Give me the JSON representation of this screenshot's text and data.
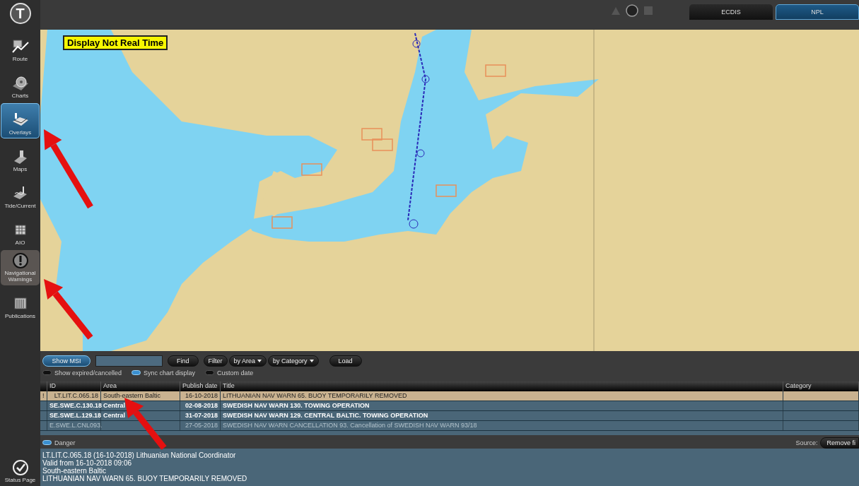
{
  "logo": "T",
  "sidebar": {
    "items": [
      {
        "label": "Route",
        "on": false,
        "selected": false
      },
      {
        "label": "Charts",
        "on": false,
        "selected": false
      },
      {
        "label": "Overlays",
        "on": true,
        "selected": false
      },
      {
        "label": "Maps",
        "on": false,
        "selected": false
      },
      {
        "label": "Tide/Current",
        "on": false,
        "selected": false
      },
      {
        "label": "AIO",
        "on": false,
        "selected": false
      },
      {
        "label": "Navigational Warnings",
        "on": false,
        "selected": true
      },
      {
        "label": "Publications",
        "on": false,
        "selected": false
      }
    ],
    "status": {
      "label": "Status Page"
    }
  },
  "top_tabs": [
    {
      "label": "ECDIS",
      "selected": false
    },
    {
      "label": "NPL",
      "selected": true
    }
  ],
  "map": {
    "banner": "Display Not Real Time"
  },
  "toolbar": {
    "show_msi": {
      "label": "Show MSI",
      "on": true
    },
    "find": "Find",
    "filter": "Filter",
    "dropdowns": [
      "by Area",
      "by Category"
    ],
    "load": "Load"
  },
  "options": [
    {
      "label": "Show expired/cancelled",
      "checked": false
    },
    {
      "label": "Sync chart display",
      "checked": true
    },
    {
      "label": "Custom date",
      "checked": false
    }
  ],
  "table": {
    "columns": [
      "ID",
      "Area",
      "Publish date",
      "Title",
      "Category"
    ],
    "rows": [
      {
        "flag": "!",
        "id": "LT.LIT.C.065.18",
        "area": "South-eastern Baltic",
        "date": "16-10-2018",
        "title": "LITHUANIAN NAV WARN 65. BUOY TEMPORARILY REMOVED",
        "selected": true,
        "unread": false,
        "expired": false
      },
      {
        "id": "SE.SWE.C.130.18",
        "area": "Central",
        "date": "02-08-2018",
        "title": "SWEDISH NAV WARN 130. TOWING OPERATION",
        "selected": false,
        "unread": true,
        "expired": false
      },
      {
        "id": "SE.SWE.L.129.18",
        "area": "Central",
        "date": "31-07-2018",
        "title": "SWEDISH NAV WARN 129. CENTRAL BALTIC. TOWING OPERATION",
        "selected": false,
        "unread": true,
        "expired": false
      },
      {
        "id": "E.SWE.L.CNL093.",
        "date": "27-05-2018",
        "title": "SWEDISH NAV WARN CANCELLATION 93. Cancellation of SWEDISH NAV WARN 93/18",
        "selected": false,
        "unread": false,
        "expired": true
      }
    ]
  },
  "detail_bar": {
    "danger": {
      "label": "Danger",
      "checked": true
    },
    "source_label": "Source:",
    "remove_button": "Remove fi"
  },
  "detail": [
    "LT.LIT.C.065.18 (16-10-2018) Lithuanian National Coordinator",
    "Valid from 16-10-2018 09:06",
    "South-eastern Baltic",
    "LITHUANIAN NAV WARN 65. BUOY TEMPORARILY REMOVED"
  ]
}
